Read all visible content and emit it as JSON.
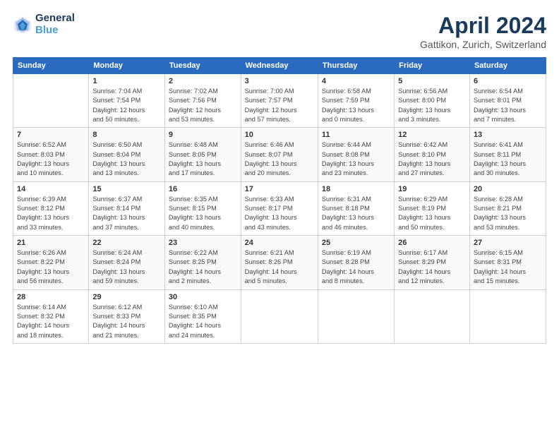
{
  "header": {
    "logo_line1": "General",
    "logo_line2": "Blue",
    "month": "April 2024",
    "location": "Gattikon, Zurich, Switzerland"
  },
  "days_of_week": [
    "Sunday",
    "Monday",
    "Tuesday",
    "Wednesday",
    "Thursday",
    "Friday",
    "Saturday"
  ],
  "weeks": [
    [
      {
        "day": "",
        "info": ""
      },
      {
        "day": "1",
        "info": "Sunrise: 7:04 AM\nSunset: 7:54 PM\nDaylight: 12 hours\nand 50 minutes."
      },
      {
        "day": "2",
        "info": "Sunrise: 7:02 AM\nSunset: 7:56 PM\nDaylight: 12 hours\nand 53 minutes."
      },
      {
        "day": "3",
        "info": "Sunrise: 7:00 AM\nSunset: 7:57 PM\nDaylight: 12 hours\nand 57 minutes."
      },
      {
        "day": "4",
        "info": "Sunrise: 6:58 AM\nSunset: 7:59 PM\nDaylight: 13 hours\nand 0 minutes."
      },
      {
        "day": "5",
        "info": "Sunrise: 6:56 AM\nSunset: 8:00 PM\nDaylight: 13 hours\nand 3 minutes."
      },
      {
        "day": "6",
        "info": "Sunrise: 6:54 AM\nSunset: 8:01 PM\nDaylight: 13 hours\nand 7 minutes."
      }
    ],
    [
      {
        "day": "7",
        "info": "Sunrise: 6:52 AM\nSunset: 8:03 PM\nDaylight: 13 hours\nand 10 minutes."
      },
      {
        "day": "8",
        "info": "Sunrise: 6:50 AM\nSunset: 8:04 PM\nDaylight: 13 hours\nand 13 minutes."
      },
      {
        "day": "9",
        "info": "Sunrise: 6:48 AM\nSunset: 8:05 PM\nDaylight: 13 hours\nand 17 minutes."
      },
      {
        "day": "10",
        "info": "Sunrise: 6:46 AM\nSunset: 8:07 PM\nDaylight: 13 hours\nand 20 minutes."
      },
      {
        "day": "11",
        "info": "Sunrise: 6:44 AM\nSunset: 8:08 PM\nDaylight: 13 hours\nand 23 minutes."
      },
      {
        "day": "12",
        "info": "Sunrise: 6:42 AM\nSunset: 8:10 PM\nDaylight: 13 hours\nand 27 minutes."
      },
      {
        "day": "13",
        "info": "Sunrise: 6:41 AM\nSunset: 8:11 PM\nDaylight: 13 hours\nand 30 minutes."
      }
    ],
    [
      {
        "day": "14",
        "info": "Sunrise: 6:39 AM\nSunset: 8:12 PM\nDaylight: 13 hours\nand 33 minutes."
      },
      {
        "day": "15",
        "info": "Sunrise: 6:37 AM\nSunset: 8:14 PM\nDaylight: 13 hours\nand 37 minutes."
      },
      {
        "day": "16",
        "info": "Sunrise: 6:35 AM\nSunset: 8:15 PM\nDaylight: 13 hours\nand 40 minutes."
      },
      {
        "day": "17",
        "info": "Sunrise: 6:33 AM\nSunset: 8:17 PM\nDaylight: 13 hours\nand 43 minutes."
      },
      {
        "day": "18",
        "info": "Sunrise: 6:31 AM\nSunset: 8:18 PM\nDaylight: 13 hours\nand 46 minutes."
      },
      {
        "day": "19",
        "info": "Sunrise: 6:29 AM\nSunset: 8:19 PM\nDaylight: 13 hours\nand 50 minutes."
      },
      {
        "day": "20",
        "info": "Sunrise: 6:28 AM\nSunset: 8:21 PM\nDaylight: 13 hours\nand 53 minutes."
      }
    ],
    [
      {
        "day": "21",
        "info": "Sunrise: 6:26 AM\nSunset: 8:22 PM\nDaylight: 13 hours\nand 56 minutes."
      },
      {
        "day": "22",
        "info": "Sunrise: 6:24 AM\nSunset: 8:24 PM\nDaylight: 13 hours\nand 59 minutes."
      },
      {
        "day": "23",
        "info": "Sunrise: 6:22 AM\nSunset: 8:25 PM\nDaylight: 14 hours\nand 2 minutes."
      },
      {
        "day": "24",
        "info": "Sunrise: 6:21 AM\nSunset: 8:26 PM\nDaylight: 14 hours\nand 5 minutes."
      },
      {
        "day": "25",
        "info": "Sunrise: 6:19 AM\nSunset: 8:28 PM\nDaylight: 14 hours\nand 8 minutes."
      },
      {
        "day": "26",
        "info": "Sunrise: 6:17 AM\nSunset: 8:29 PM\nDaylight: 14 hours\nand 12 minutes."
      },
      {
        "day": "27",
        "info": "Sunrise: 6:15 AM\nSunset: 8:31 PM\nDaylight: 14 hours\nand 15 minutes."
      }
    ],
    [
      {
        "day": "28",
        "info": "Sunrise: 6:14 AM\nSunset: 8:32 PM\nDaylight: 14 hours\nand 18 minutes."
      },
      {
        "day": "29",
        "info": "Sunrise: 6:12 AM\nSunset: 8:33 PM\nDaylight: 14 hours\nand 21 minutes."
      },
      {
        "day": "30",
        "info": "Sunrise: 6:10 AM\nSunset: 8:35 PM\nDaylight: 14 hours\nand 24 minutes."
      },
      {
        "day": "",
        "info": ""
      },
      {
        "day": "",
        "info": ""
      },
      {
        "day": "",
        "info": ""
      },
      {
        "day": "",
        "info": ""
      }
    ]
  ]
}
